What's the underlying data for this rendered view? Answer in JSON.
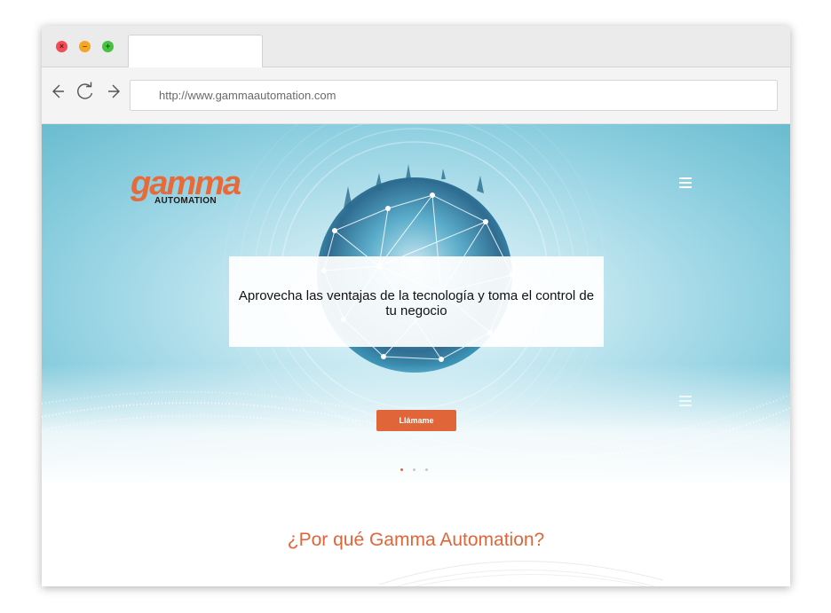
{
  "browser": {
    "address": "http://www.gammaautomation.com",
    "tab_title": ""
  },
  "hero": {
    "logo_word": "gamma",
    "logo_sub": "AUTOMATION",
    "headline": "Aprovecha las ventajas de la tecnología y toma el control de tu negocio",
    "cta_label": "Llámame",
    "slides": {
      "count": 3,
      "active": 1
    }
  },
  "section": {
    "title": "¿Por qué Gamma Automation?"
  },
  "icons": {
    "close": "close-icon",
    "minimize": "minimize-icon",
    "maximize": "maximize-icon",
    "back": "arrow-left-icon",
    "reload": "reload-icon",
    "forward": "arrow-right-icon",
    "menu": "hamburger-menu-icon",
    "globe": "network-globe-icon"
  },
  "colors": {
    "accent": "#e0663a",
    "hero_light": "#e9f7fb",
    "hero_dark": "#69bccf",
    "dot_active": "#e0663a",
    "dot_inactive": "#c7c7c7"
  }
}
